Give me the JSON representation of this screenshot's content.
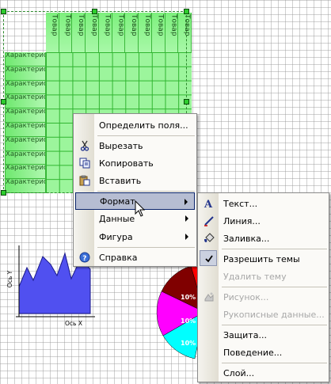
{
  "matrix": {
    "column_header": "Товар",
    "column_count": 11,
    "row_header": "Характеристика",
    "row_count": 10
  },
  "area_chart": {
    "y_axis_label": "Ось Y",
    "x_axis_label": "Ось X"
  },
  "pie": {
    "slice_label": "10%",
    "colors": [
      "#ff0000",
      "#800000",
      "#ff00ff",
      "#00ffff"
    ]
  },
  "context_menu": {
    "items": [
      {
        "label": "Определить поля...",
        "icon": "none"
      },
      {
        "label": "Вырезать",
        "icon": "scissors-icon"
      },
      {
        "label": "Копировать",
        "icon": "copy-icon"
      },
      {
        "label": "Вставить",
        "icon": "paste-icon"
      },
      {
        "label": "Формат",
        "icon": "none",
        "submenu": true,
        "highlighted": true
      },
      {
        "label": "Данные",
        "icon": "none",
        "submenu": true
      },
      {
        "label": "Фигура",
        "icon": "none",
        "submenu": true
      },
      {
        "label": "Справка",
        "icon": "help-icon"
      }
    ]
  },
  "format_submenu": {
    "items": [
      {
        "label": "Текст...",
        "icon": "text-icon"
      },
      {
        "label": "Линия...",
        "icon": "line-icon"
      },
      {
        "label": "Заливка...",
        "icon": "fill-icon"
      },
      {
        "label": "Разрешить темы",
        "icon": "check-icon",
        "checked": true
      },
      {
        "label": "Удалить тему",
        "disabled": true
      },
      {
        "label": "Рисунок...",
        "icon": "picture-icon",
        "disabled": true
      },
      {
        "label": "Рукописные данные...",
        "disabled": true
      },
      {
        "label": "Защита..."
      },
      {
        "label": "Поведение..."
      },
      {
        "label": "Слой..."
      }
    ]
  },
  "colors": {
    "menu_highlight": "#b6bdd2",
    "table_fill": "#8ff08f",
    "area_fill": "#5050f0"
  }
}
